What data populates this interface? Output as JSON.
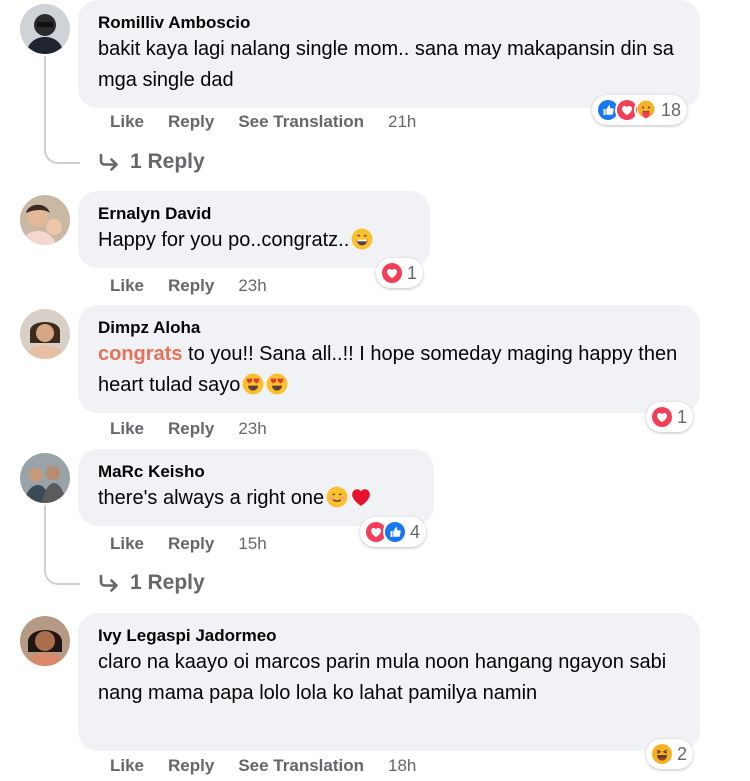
{
  "comments": [
    {
      "author": "Romilliv Amboscio",
      "text": "bakit kaya lagi nalang single mom.. sana may makapansin din sa mga single dad",
      "reaction_count": "18",
      "reaction_icons": [
        "like-icon",
        "love-icon",
        "care-icon"
      ],
      "actions": {
        "like": "Like",
        "reply": "Reply",
        "translate": "See Translation",
        "time": "21h"
      },
      "replies": "1 Reply"
    },
    {
      "author": "Ernalyn David",
      "text": "Happy for you po..congratz..",
      "reaction_count": "1",
      "reaction_icons": [
        "love-icon"
      ],
      "actions": {
        "like": "Like",
        "reply": "Reply",
        "time": "23h"
      }
    },
    {
      "author": "Dimpz Aloha",
      "tag": "congrats",
      "text": " to you!! Sana all..!! I hope someday maging happy then heart tulad sayo",
      "reaction_count": "1",
      "reaction_icons": [
        "love-icon"
      ],
      "actions": {
        "like": "Like",
        "reply": "Reply",
        "time": "23h"
      }
    },
    {
      "author": "MaRc Keisho",
      "text": "there's always a right one",
      "reaction_count": "4",
      "reaction_icons": [
        "love-icon",
        "like-icon"
      ],
      "actions": {
        "like": "Like",
        "reply": "Reply",
        "time": "15h"
      },
      "replies": "1 Reply"
    },
    {
      "author": "Ivy Legaspi Jadormeo",
      "text": "claro na kaayo oi marcos parin mula noon hangang ngayon sabi nang mama papa lolo lola ko lahat pamilya namin",
      "reaction_count": "2",
      "reaction_icons": [
        "haha-icon"
      ],
      "actions": {
        "like": "Like",
        "reply": "Reply",
        "translate": "See Translation",
        "time": "18h"
      }
    }
  ],
  "colors": {
    "bubble": "#f0f2f5",
    "secondary_text": "#65676b",
    "like_blue": "#1877f2",
    "love_red": "#f33e58",
    "haha_yellow": "#f7b125",
    "tag_orange": "#e9715a"
  }
}
